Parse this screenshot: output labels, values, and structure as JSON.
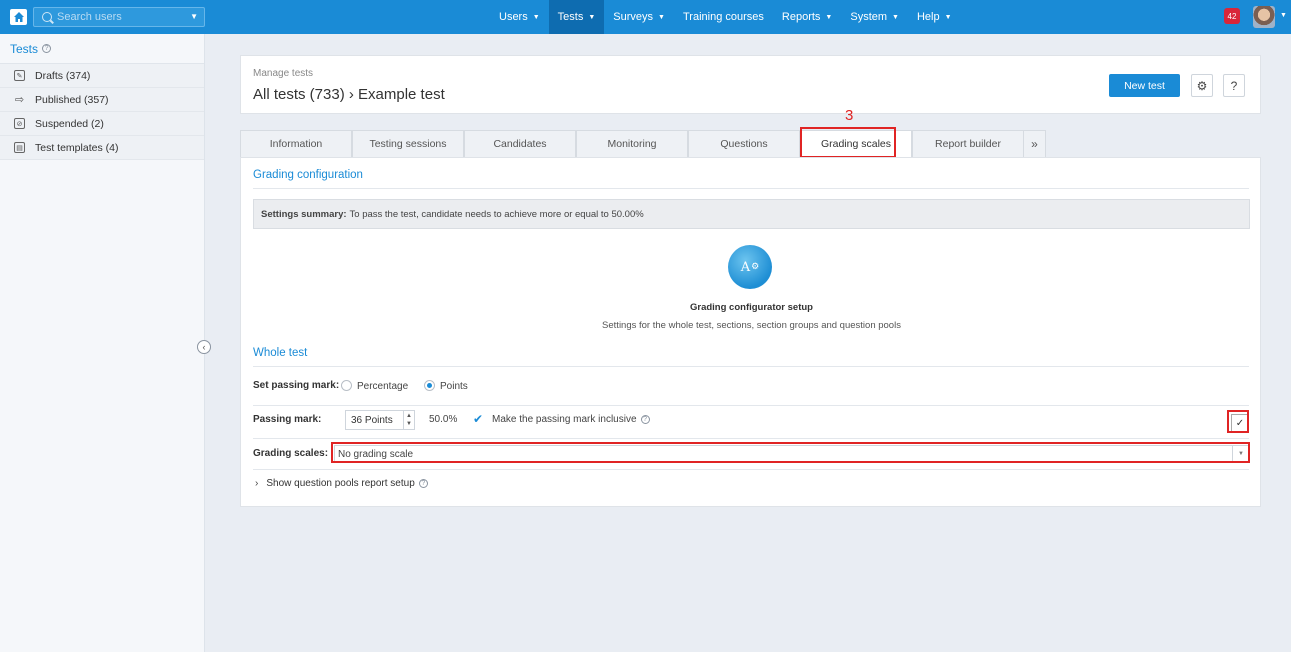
{
  "topbar": {
    "search_placeholder": "Search users",
    "nav": [
      {
        "label": "Users",
        "caret": true,
        "active": false
      },
      {
        "label": "Tests",
        "caret": true,
        "active": true
      },
      {
        "label": "Surveys",
        "caret": true,
        "active": false
      },
      {
        "label": "Training courses",
        "caret": false,
        "active": false
      },
      {
        "label": "Reports",
        "caret": true,
        "active": false
      },
      {
        "label": "System",
        "caret": true,
        "active": false
      },
      {
        "label": "Help",
        "caret": true,
        "active": false
      }
    ],
    "notification_count": "42"
  },
  "sidebar": {
    "title": "Tests",
    "items": [
      {
        "label": "Drafts (374)",
        "icon": "pencil-icon"
      },
      {
        "label": "Published (357)",
        "icon": "export-icon"
      },
      {
        "label": "Suspended (2)",
        "icon": "suspended-icon"
      },
      {
        "label": "Test templates (4)",
        "icon": "template-icon"
      }
    ]
  },
  "header": {
    "small_label": "Manage tests",
    "title": "All tests (733) › Example test",
    "new_test_label": "New test",
    "help_label": "?"
  },
  "tabs": [
    {
      "label": "Information",
      "active": false
    },
    {
      "label": "Testing sessions",
      "active": false
    },
    {
      "label": "Candidates",
      "active": false
    },
    {
      "label": "Monitoring",
      "active": false
    },
    {
      "label": "Questions",
      "active": false
    },
    {
      "label": "Grading scales",
      "active": true
    },
    {
      "label": "Report builder",
      "active": false
    }
  ],
  "annotation_number": "3",
  "panel": {
    "grading_config_title": "Grading configuration",
    "summary_bold": "Settings summary:",
    "summary_text": "To pass the test, candidate needs to achieve more or equal to 50.00%",
    "gc_icon_text": "A",
    "gc_title": "Grading configurator setup",
    "gc_subtitle": "Settings for the whole test, sections, section groups and question pools",
    "whole_test_title": "Whole test",
    "set_passing_mark_label": "Set passing mark:",
    "option_percentage": "Percentage",
    "option_points": "Points",
    "selected_option": "Points",
    "passing_mark_label": "Passing mark:",
    "passing_mark_value": "36 Points",
    "passing_mark_percent": "50.0%",
    "inclusive_label": "Make the passing mark inclusive",
    "inclusive_checked": true,
    "grading_scales_label": "Grading scales:",
    "grading_scales_value": "No grading scale",
    "show_pools_label": "Show question pools report setup"
  },
  "colors": {
    "brand_blue": "#1a8bd6",
    "annotation_red": "#e02424"
  }
}
